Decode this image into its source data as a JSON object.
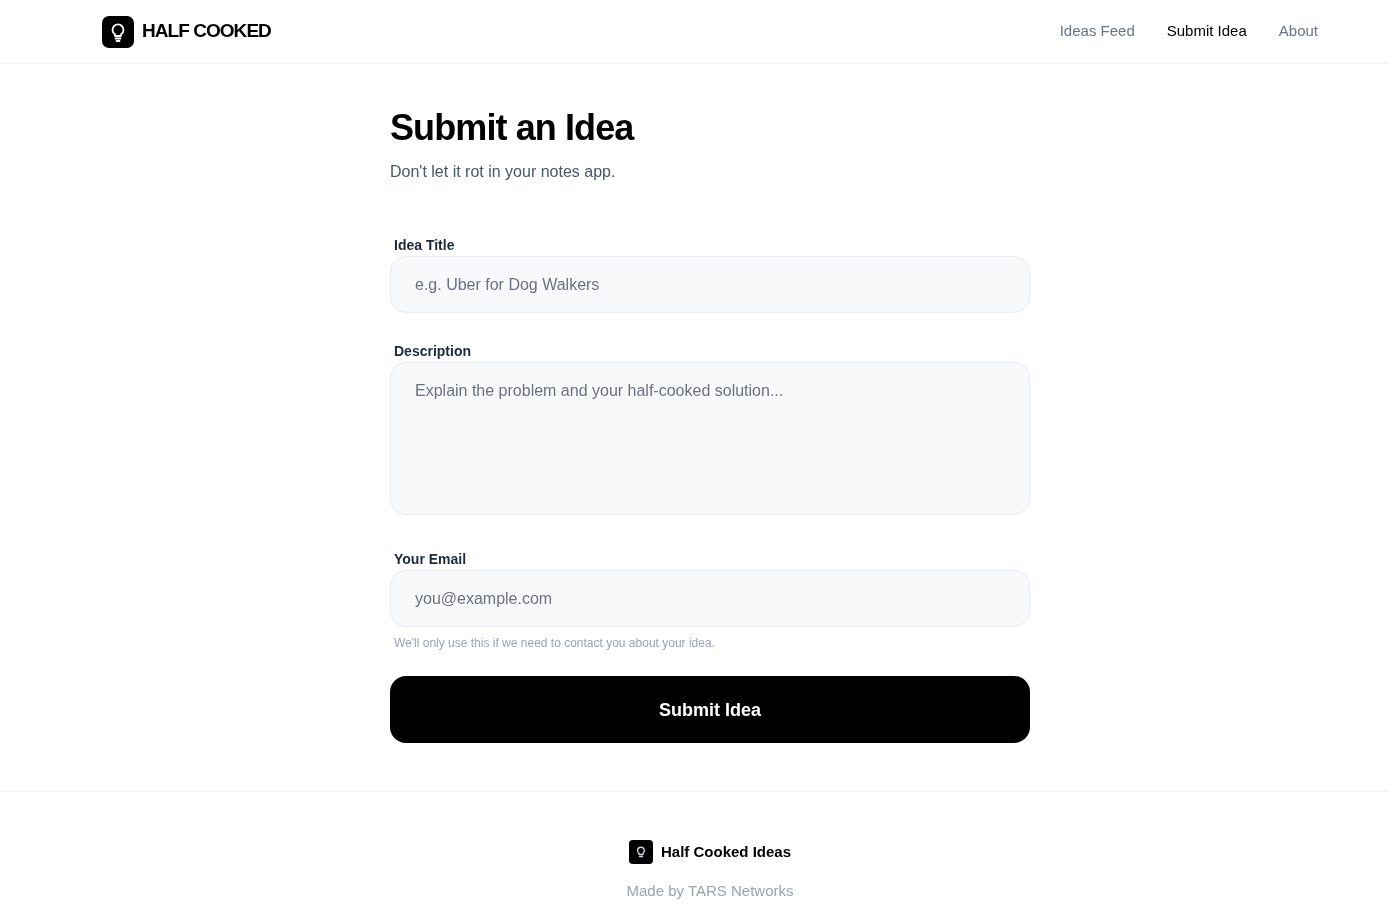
{
  "brand": {
    "name": "HALF COOKED"
  },
  "nav": [
    {
      "label": "Ideas Feed",
      "selected": false
    },
    {
      "label": "Submit Idea",
      "selected": true
    },
    {
      "label": "About",
      "selected": false
    }
  ],
  "page": {
    "title": "Submit an Idea",
    "subtitle": "Don't let it rot in your notes app."
  },
  "form": {
    "fields": [
      {
        "kind": "text",
        "label": "Idea Title",
        "placeholder": "e.g. Uber for Dog Walkers"
      },
      {
        "kind": "textarea",
        "label": "Description",
        "placeholder": "Explain the problem and your half-cooked solution..."
      },
      {
        "kind": "email",
        "label": "Your Email",
        "placeholder": "you@example.com",
        "hint": "We'll only use this if we need to contact you about your idea."
      }
    ],
    "submit": "Submit Idea"
  },
  "footer": {
    "brand": "Half Cooked Ideas",
    "credit": "Made by TARS Networks"
  }
}
